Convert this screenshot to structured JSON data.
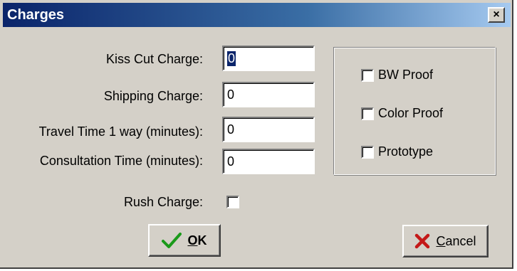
{
  "window": {
    "title": "Charges",
    "close_glyph": "×"
  },
  "fields": [
    {
      "label": "Kiss Cut Charge:",
      "value": "0"
    },
    {
      "label": "Shipping Charge:",
      "value": "0"
    },
    {
      "label": "Travel Time 1 way (minutes):",
      "value": "0"
    },
    {
      "label": "Consultation Time (minutes):",
      "value": "0"
    }
  ],
  "rush": {
    "label": "Rush Charge:",
    "checked": false
  },
  "options": [
    {
      "label": "BW Proof",
      "checked": false
    },
    {
      "label": "Color Proof",
      "checked": false
    },
    {
      "label": "Prototype",
      "checked": false
    }
  ],
  "buttons": {
    "ok": {
      "mnemonic": "O",
      "rest": "K",
      "icon": "checkmark-icon",
      "icon_color": "#1a9a1a"
    },
    "cancel": {
      "mnemonic": "C",
      "rest": "ancel",
      "icon": "x-mark-icon",
      "icon_color": "#c41818"
    }
  },
  "colors": {
    "dialog_bg": "#d4d0c8",
    "title_gradient_start": "#0a246a",
    "title_gradient_end": "#a6caf0",
    "selection": "#0a246a"
  }
}
